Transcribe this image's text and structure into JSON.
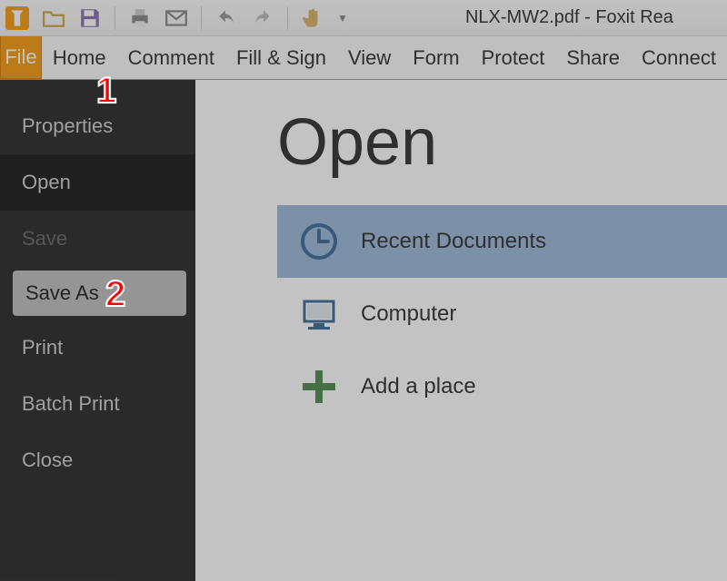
{
  "window": {
    "title": "NLX-MW2.pdf - Foxit Rea"
  },
  "qat_icons": [
    "foxit-logo",
    "open-file",
    "save",
    "print",
    "mail",
    "undo",
    "redo",
    "hand-tool"
  ],
  "tabs": {
    "file": "File",
    "items": [
      "Home",
      "Comment",
      "Fill & Sign",
      "View",
      "Form",
      "Protect",
      "Share",
      "Connect"
    ]
  },
  "sidebar": {
    "items": [
      {
        "label": "Properties",
        "state": "normal"
      },
      {
        "label": "Open",
        "state": "dark"
      },
      {
        "label": "Save",
        "state": "disabled"
      },
      {
        "label": "Save As",
        "state": "selected"
      },
      {
        "label": "Print",
        "state": "normal"
      },
      {
        "label": "Batch Print",
        "state": "normal"
      },
      {
        "label": "Close",
        "state": "normal"
      }
    ]
  },
  "main": {
    "heading": "Open",
    "rows": [
      {
        "icon": "clock",
        "label": "Recent Documents",
        "selected": true
      },
      {
        "icon": "computer",
        "label": "Computer",
        "selected": false
      },
      {
        "icon": "plus",
        "label": "Add a place",
        "selected": false
      }
    ]
  },
  "annotations": {
    "1": "1",
    "2": "2"
  },
  "colors": {
    "accent": "#f39b12",
    "sidebar": "#2c2c2c",
    "highlight": "#9db9d9",
    "plus": "#4f8d4f"
  }
}
